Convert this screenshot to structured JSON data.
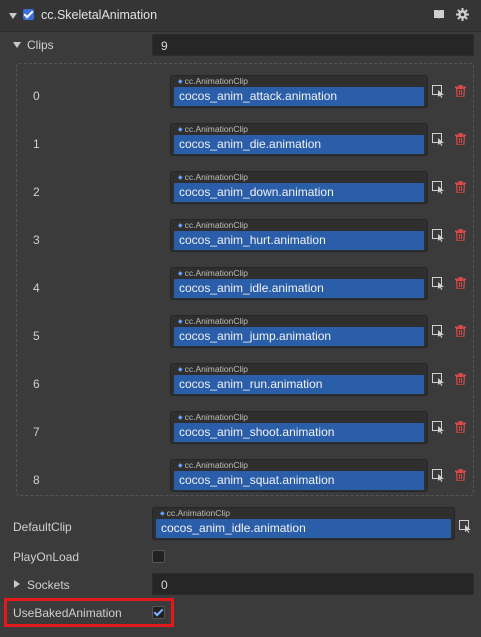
{
  "component": {
    "title": "cc.SkeletalAnimation",
    "enabled": true
  },
  "clips": {
    "label": "Clips",
    "count": "9",
    "asset_type": "cc.AnimationClip",
    "items": [
      {
        "index": "0",
        "name": "cocos_anim_attack.animation"
      },
      {
        "index": "1",
        "name": "cocos_anim_die.animation"
      },
      {
        "index": "2",
        "name": "cocos_anim_down.animation"
      },
      {
        "index": "3",
        "name": "cocos_anim_hurt.animation"
      },
      {
        "index": "4",
        "name": "cocos_anim_idle.animation"
      },
      {
        "index": "5",
        "name": "cocos_anim_jump.animation"
      },
      {
        "index": "6",
        "name": "cocos_anim_run.animation"
      },
      {
        "index": "7",
        "name": "cocos_anim_shoot.animation"
      },
      {
        "index": "8",
        "name": "cocos_anim_squat.animation"
      }
    ]
  },
  "default_clip": {
    "label": "DefaultClip",
    "asset_type": "cc.AnimationClip",
    "value": "cocos_anim_idle.animation"
  },
  "play_on_load": {
    "label": "PlayOnLoad",
    "checked": false
  },
  "sockets": {
    "label": "Sockets",
    "count": "0"
  },
  "use_baked_animation": {
    "label": "UseBakedAnimation",
    "checked": true
  },
  "colors": {
    "panel_bg": "#3b3b3b",
    "asset_field": "#2b5ea8",
    "accent": "#3a6fd8",
    "delete": "#d84a4a",
    "highlight": "#e01a1a"
  },
  "icons": {
    "collapse": "chevron-down-icon",
    "docs": "book-icon",
    "settings": "gear-icon",
    "pick": "asset-pick-icon",
    "delete": "trash-icon"
  }
}
